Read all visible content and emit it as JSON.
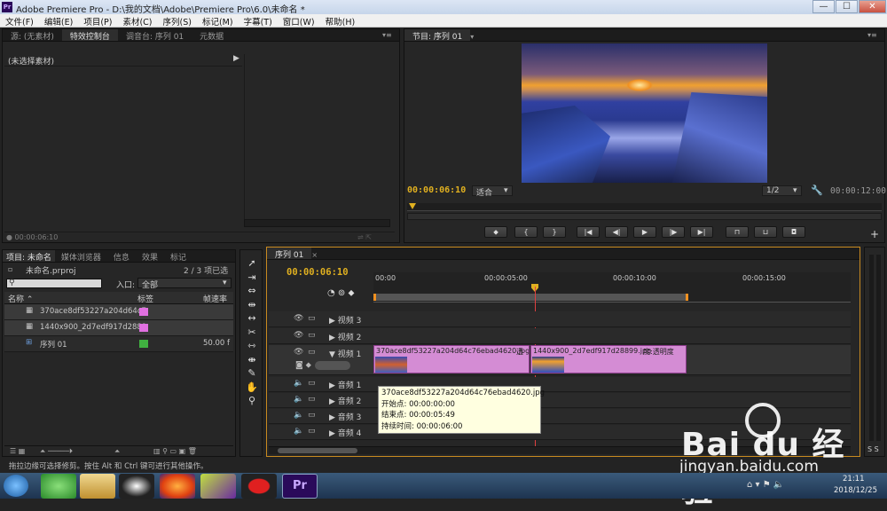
{
  "window": {
    "title": "Adobe Premiere Pro - D:\\我的文档\\Adobe\\Premiere Pro\\6.0\\未命名 *",
    "minimize": "—",
    "maximize": "☐",
    "close": "✕"
  },
  "menu": [
    "文件(F)",
    "编辑(E)",
    "项目(P)",
    "素材(C)",
    "序列(S)",
    "标记(M)",
    "字幕(T)",
    "窗口(W)",
    "帮助(H)"
  ],
  "source_panel": {
    "tabs": [
      "源: (无素材)",
      "特效控制台",
      "调音台: 序列 01",
      "元数据"
    ],
    "header": "(未选择素材)",
    "timecode": "00:00:06:10"
  },
  "program": {
    "tab": "节目: 序列 01",
    "timecode": "00:00:06:10",
    "fit": "适合",
    "res": "1/2",
    "duration": "00:00:12:00"
  },
  "project": {
    "tabs": [
      "项目: 未命名",
      "媒体浏览器",
      "信息",
      "效果",
      "标记"
    ],
    "file": "未命名.prproj",
    "selected": "2 / 3 项已选择",
    "in_label": "入口:",
    "in_value": "全部",
    "cols": {
      "name": "名称",
      "label": "标签",
      "fps": "帧速率"
    },
    "items": [
      {
        "name": "370ace8df53227a204d64c7",
        "fps": "",
        "color": "#e070e0"
      },
      {
        "name": "1440x900_2d7edf917d2889",
        "fps": "",
        "color": "#e070e0"
      },
      {
        "name": "序列 01",
        "fps": "50.00 f",
        "color": "#40b040"
      }
    ]
  },
  "timeline": {
    "tab": "序列 01",
    "timecode": "00:00:06:10",
    "ruler": [
      "00:00",
      "00:00:05:00",
      "00:00:10:00",
      "00:00:15:00"
    ],
    "tracks": {
      "v3": "视频 3",
      "v2": "视频 2",
      "v1": "视频 1",
      "a1": "音频 1",
      "a2": "音频 2",
      "a3": "音频 3",
      "a4": "音频 4"
    },
    "clip1": "370ace8df53227a204d64c76ebad4620.jpg",
    "clip1_fx": "透",
    "clip2": "1440x900_2d7edf917d28899.jpg",
    "clip2_fx": "度:透明度",
    "tooltip": {
      "name": "370ace8df53227a204d64c76ebad4620.jpg",
      "start": "开始点: 00:00:00:00",
      "end": "结束点: 00:00:05:49",
      "dur": "持续时间: 00:00:06:00"
    }
  },
  "status": "拖拉边缘可选择修剪。按住 Alt 和 Ctrl 键可进行其他操作。",
  "watermark": {
    "brand": "Bai du 经验",
    "url": "jingyan.baidu.com"
  },
  "taskbar": {
    "time": "21:11",
    "date": "2018/12/25",
    "pr": "Pr"
  }
}
